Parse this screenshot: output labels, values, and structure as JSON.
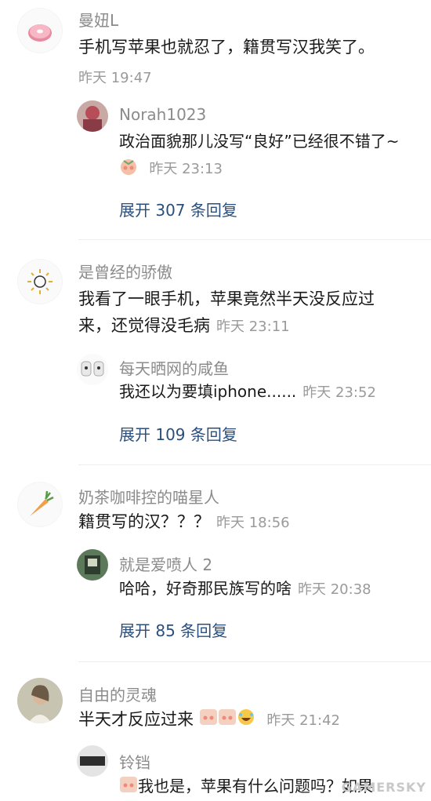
{
  "comments": [
    {
      "name": "曼妞L",
      "text": "手机写苹果也就忍了，籍贯写汉我笑了。",
      "time": "昨天 19:47",
      "reply": {
        "name": "Norah1023",
        "text": "政治面貌那儿没写“良好”已经很不错了~",
        "time": "昨天 23:13"
      },
      "expand": "展开 307 条回复"
    },
    {
      "name": "是曾经的骄傲",
      "text_line1": "我看了一眼手机，苹果竟然半天没反应过",
      "text_line2": "来，还觉得没毛病",
      "time": "昨天 23:11",
      "reply": {
        "name": "每天晒网的咸鱼",
        "text": "我还以为要填iphone......",
        "time": "昨天 23:52"
      },
      "expand": "展开 109 条回复"
    },
    {
      "name": "奶茶咖啡控的喵星人",
      "text": "籍贯写的汉？？？",
      "time": "昨天 18:56",
      "reply": {
        "name": "就是爱喷人 2",
        "text": "哈哈，好奇那民族写的啥",
        "time": "昨天 20:38"
      },
      "expand": "展开 85 条回复"
    },
    {
      "name": "自由的灵魂",
      "text": "半天才反应过来",
      "time": "昨天 21:42",
      "reply": {
        "name": "铃铛",
        "text": "我也是，苹果有什么问题吗？如果"
      }
    }
  ],
  "watermark": "GAMERSKY",
  "colors": {
    "link": "#2b4f7c",
    "meta": "#9a9a9a",
    "text": "#1a1a1a"
  }
}
